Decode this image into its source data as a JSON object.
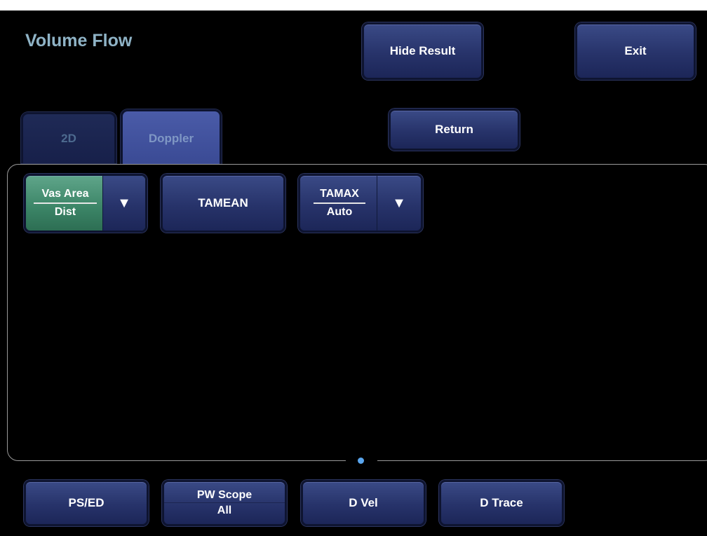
{
  "header": {
    "title": "Volume Flow",
    "hide_result_label": "Hide Result",
    "exit_label": "Exit"
  },
  "tabs": [
    {
      "label": "2D",
      "active": false
    },
    {
      "label": "Doppler",
      "active": true
    }
  ],
  "return_label": "Return",
  "tools": {
    "vas_area": {
      "top": "Vas Area",
      "bottom": "Dist"
    },
    "tamean_label": "TAMEAN",
    "tamax": {
      "top": "TAMAX",
      "bottom": "Auto"
    },
    "dropdown_glyph": "▼"
  },
  "bottom_bar": {
    "ps_ed_label": "PS/ED",
    "pw_scope": {
      "top": "PW Scope",
      "bottom": "All"
    },
    "d_vel_label": "D Vel",
    "d_trace_label": "D Trace"
  },
  "colors": {
    "title": "#8fb3c6",
    "button_navy": "#27336a",
    "button_green": "#3b8466",
    "page_indicator": "#5aa6ee"
  }
}
